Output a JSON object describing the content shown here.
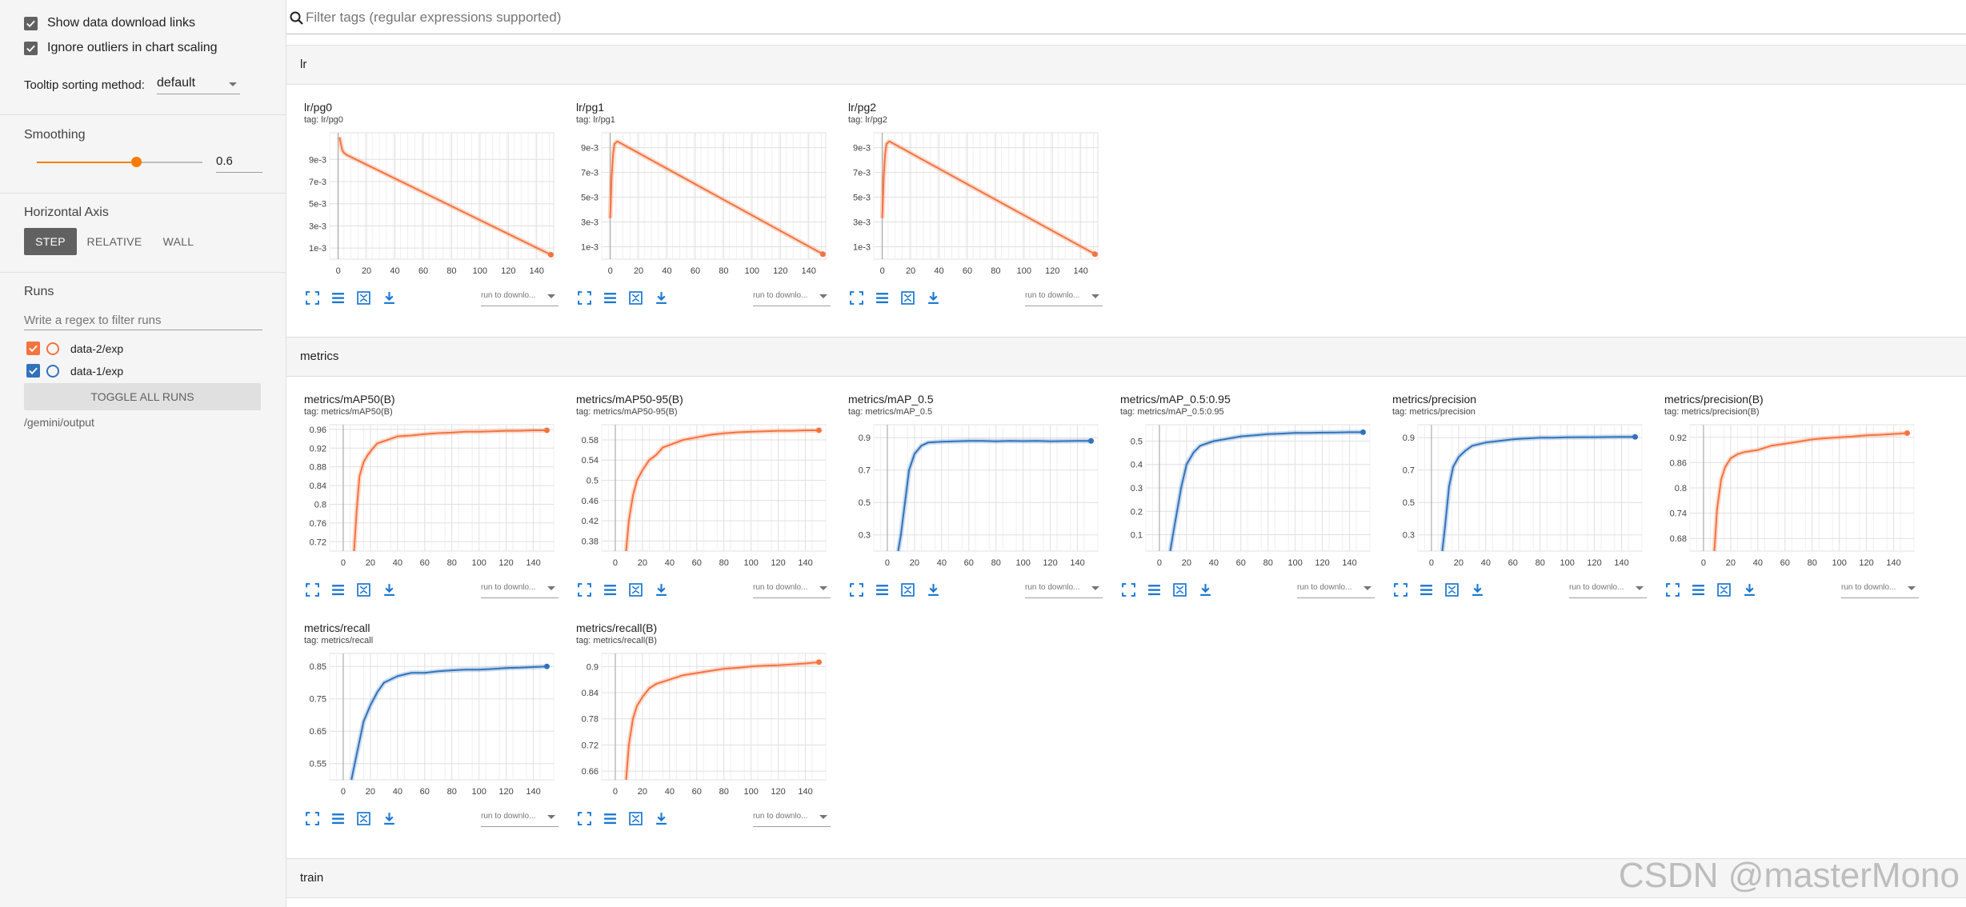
{
  "sidebar": {
    "show_download_links": "Show data download links",
    "ignore_outliers": "Ignore outliers in chart scaling",
    "tooltip_label": "Tooltip sorting method:",
    "tooltip_value": "default",
    "smoothing_label": "Smoothing",
    "smoothing_value": "0.6",
    "horizontal_axis_label": "Horizontal Axis",
    "axis_options": [
      "STEP",
      "RELATIVE",
      "WALL"
    ],
    "runs_label": "Runs",
    "runs_filter_placeholder": "Write a regex to filter runs",
    "runs": [
      {
        "name": "data-2/exp",
        "color": "#f4733f"
      },
      {
        "name": "data-1/exp",
        "color": "#3172bb"
      }
    ],
    "toggle_all": "TOGGLE ALL RUNS",
    "logdir": "/gemini/output"
  },
  "filter": {
    "placeholder": "Filter tags (regular expressions supported)"
  },
  "groups": [
    "lr",
    "metrics",
    "train"
  ],
  "card_run_select": "run to downlo...",
  "colors": {
    "orange": "#f4733f",
    "blue": "#3172bb",
    "accent": "#f57c00",
    "step_btn": "#616161"
  },
  "watermark": "CSDN @masterMono",
  "chart_data": [
    {
      "type": "line",
      "title": "lr/pg0",
      "tag": "tag: lr/pg0",
      "series_color": "orange",
      "xticks": [
        0,
        20,
        40,
        60,
        80,
        100,
        120,
        140
      ],
      "yticks": [
        {
          "label": "9e-3",
          "v": 0.009
        },
        {
          "label": "7e-3",
          "v": 0.007
        },
        {
          "label": "5e-3",
          "v": 0.005
        },
        {
          "label": "3e-3",
          "v": 0.003
        },
        {
          "label": "1e-3",
          "v": 0.001
        }
      ],
      "xlim": [
        -6,
        152
      ],
      "ylim": [
        0,
        0.0114
      ],
      "x": [
        1,
        2,
        3,
        4,
        6,
        150
      ],
      "y": [
        0.011,
        0.0103,
        0.0098,
        0.0096,
        0.0094,
        0.0004
      ]
    },
    {
      "type": "line",
      "title": "lr/pg1",
      "tag": "tag: lr/pg1",
      "series_color": "orange",
      "xticks": [
        0,
        20,
        40,
        60,
        80,
        100,
        120,
        140
      ],
      "yticks": [
        {
          "label": "9e-3",
          "v": 0.009
        },
        {
          "label": "7e-3",
          "v": 0.007
        },
        {
          "label": "5e-3",
          "v": 0.005
        },
        {
          "label": "3e-3",
          "v": 0.003
        },
        {
          "label": "1e-3",
          "v": 0.001
        }
      ],
      "xlim": [
        -6,
        152
      ],
      "ylim": [
        0,
        0.0102
      ],
      "x": [
        0,
        1,
        2,
        3,
        5,
        150
      ],
      "y": [
        0.0033,
        0.0066,
        0.0085,
        0.0093,
        0.0095,
        0.0004
      ]
    },
    {
      "type": "line",
      "title": "lr/pg2",
      "tag": "tag: lr/pg2",
      "series_color": "orange",
      "xticks": [
        0,
        20,
        40,
        60,
        80,
        100,
        120,
        140
      ],
      "yticks": [
        {
          "label": "9e-3",
          "v": 0.009
        },
        {
          "label": "7e-3",
          "v": 0.007
        },
        {
          "label": "5e-3",
          "v": 0.005
        },
        {
          "label": "3e-3",
          "v": 0.003
        },
        {
          "label": "1e-3",
          "v": 0.001
        }
      ],
      "xlim": [
        -6,
        152
      ],
      "ylim": [
        0,
        0.0102
      ],
      "x": [
        0,
        1,
        2,
        3,
        5,
        150
      ],
      "y": [
        0.0033,
        0.0066,
        0.0085,
        0.0093,
        0.0095,
        0.0004
      ]
    },
    {
      "type": "line",
      "title": "metrics/mAP50(B)",
      "tag": "tag: metrics/mAP50(B)",
      "series_color": "orange",
      "xticks": [
        0,
        20,
        40,
        60,
        80,
        100,
        120,
        140
      ],
      "yticks": [
        {
          "label": "0.96",
          "v": 0.96
        },
        {
          "label": "0.92",
          "v": 0.92
        },
        {
          "label": "0.88",
          "v": 0.88
        },
        {
          "label": "0.84",
          "v": 0.84
        },
        {
          "label": "0.8",
          "v": 0.8
        },
        {
          "label": "0.76",
          "v": 0.76
        },
        {
          "label": "0.72",
          "v": 0.72
        }
      ],
      "xlim": [
        -10,
        155
      ],
      "ylim": [
        0.7,
        0.97
      ],
      "x": [
        8,
        10,
        12,
        15,
        18,
        22,
        25,
        30,
        35,
        40,
        50,
        60,
        70,
        80,
        90,
        100,
        110,
        120,
        130,
        140,
        150
      ],
      "y": [
        0.7,
        0.79,
        0.86,
        0.89,
        0.905,
        0.92,
        0.93,
        0.935,
        0.94,
        0.945,
        0.947,
        0.95,
        0.952,
        0.953,
        0.955,
        0.955,
        0.956,
        0.957,
        0.957,
        0.958,
        0.958
      ]
    },
    {
      "type": "line",
      "title": "metrics/mAP50-95(B)",
      "tag": "tag: metrics/mAP50-95(B)",
      "series_color": "orange",
      "xticks": [
        0,
        20,
        40,
        60,
        80,
        100,
        120,
        140
      ],
      "yticks": [
        {
          "label": "0.58",
          "v": 0.58
        },
        {
          "label": "0.54",
          "v": 0.54
        },
        {
          "label": "0.5",
          "v": 0.5
        },
        {
          "label": "0.46",
          "v": 0.46
        },
        {
          "label": "0.42",
          "v": 0.42
        },
        {
          "label": "0.38",
          "v": 0.38
        }
      ],
      "xlim": [
        -10,
        155
      ],
      "ylim": [
        0.36,
        0.61
      ],
      "x": [
        8,
        10,
        13,
        16,
        20,
        25,
        30,
        35,
        40,
        50,
        60,
        70,
        80,
        90,
        100,
        110,
        120,
        130,
        140,
        150
      ],
      "y": [
        0.36,
        0.42,
        0.47,
        0.5,
        0.52,
        0.54,
        0.55,
        0.565,
        0.57,
        0.58,
        0.585,
        0.59,
        0.593,
        0.595,
        0.596,
        0.597,
        0.598,
        0.598,
        0.599,
        0.599
      ]
    },
    {
      "type": "line",
      "title": "metrics/mAP_0.5",
      "tag": "tag: metrics/mAP_0.5",
      "series_color": "blue",
      "xticks": [
        0,
        20,
        40,
        60,
        80,
        100,
        120,
        140
      ],
      "yticks": [
        {
          "label": "0.9",
          "v": 0.9
        },
        {
          "label": "0.7",
          "v": 0.7
        },
        {
          "label": "0.5",
          "v": 0.5
        },
        {
          "label": "0.3",
          "v": 0.3
        }
      ],
      "xlim": [
        -10,
        155
      ],
      "ylim": [
        0.2,
        0.98
      ],
      "x": [
        8,
        10,
        13,
        16,
        20,
        25,
        30,
        40,
        50,
        60,
        70,
        80,
        90,
        100,
        110,
        120,
        130,
        140,
        150
      ],
      "y": [
        0.2,
        0.3,
        0.5,
        0.7,
        0.8,
        0.85,
        0.87,
        0.875,
        0.878,
        0.88,
        0.88,
        0.878,
        0.88,
        0.879,
        0.88,
        0.878,
        0.879,
        0.88,
        0.88
      ]
    },
    {
      "type": "line",
      "title": "metrics/mAP_0.5:0.95",
      "tag": "tag: metrics/mAP_0.5:0.95",
      "series_color": "blue",
      "xticks": [
        0,
        20,
        40,
        60,
        80,
        100,
        120,
        140
      ],
      "yticks": [
        {
          "label": "0.5",
          "v": 0.5
        },
        {
          "label": "0.4",
          "v": 0.4
        },
        {
          "label": "0.3",
          "v": 0.3
        },
        {
          "label": "0.2",
          "v": 0.2
        },
        {
          "label": "0.1",
          "v": 0.1
        }
      ],
      "xlim": [
        -10,
        155
      ],
      "ylim": [
        0.03,
        0.57
      ],
      "x": [
        8,
        10,
        13,
        16,
        20,
        25,
        30,
        40,
        50,
        60,
        70,
        80,
        90,
        100,
        110,
        120,
        130,
        140,
        150
      ],
      "y": [
        0.03,
        0.1,
        0.2,
        0.3,
        0.4,
        0.45,
        0.48,
        0.5,
        0.51,
        0.52,
        0.525,
        0.53,
        0.532,
        0.535,
        0.535,
        0.536,
        0.537,
        0.538,
        0.538
      ]
    },
    {
      "type": "line",
      "title": "metrics/precision",
      "tag": "tag: metrics/precision",
      "series_color": "blue",
      "xticks": [
        0,
        20,
        40,
        60,
        80,
        100,
        120,
        140
      ],
      "yticks": [
        {
          "label": "0.9",
          "v": 0.9
        },
        {
          "label": "0.7",
          "v": 0.7
        },
        {
          "label": "0.5",
          "v": 0.5
        },
        {
          "label": "0.3",
          "v": 0.3
        }
      ],
      "xlim": [
        -10,
        155
      ],
      "ylim": [
        0.2,
        0.98
      ],
      "x": [
        8,
        10,
        13,
        16,
        20,
        25,
        30,
        40,
        50,
        60,
        70,
        80,
        90,
        100,
        110,
        120,
        130,
        140,
        150
      ],
      "y": [
        0.2,
        0.35,
        0.6,
        0.72,
        0.78,
        0.82,
        0.85,
        0.87,
        0.88,
        0.89,
        0.895,
        0.9,
        0.9,
        0.902,
        0.903,
        0.903,
        0.904,
        0.905,
        0.905
      ]
    },
    {
      "type": "line",
      "title": "metrics/precision(B)",
      "tag": "tag: metrics/precision(B)",
      "series_color": "orange",
      "xticks": [
        0,
        20,
        40,
        60,
        80,
        100,
        120,
        140
      ],
      "yticks": [
        {
          "label": "0.92",
          "v": 0.92
        },
        {
          "label": "0.86",
          "v": 0.86
        },
        {
          "label": "0.8",
          "v": 0.8
        },
        {
          "label": "0.74",
          "v": 0.74
        },
        {
          "label": "0.68",
          "v": 0.68
        }
      ],
      "xlim": [
        -10,
        155
      ],
      "ylim": [
        0.65,
        0.95
      ],
      "x": [
        8,
        10,
        13,
        16,
        20,
        25,
        30,
        40,
        50,
        60,
        70,
        80,
        90,
        100,
        110,
        120,
        130,
        140,
        150
      ],
      "y": [
        0.65,
        0.75,
        0.82,
        0.85,
        0.87,
        0.88,
        0.885,
        0.89,
        0.9,
        0.905,
        0.91,
        0.915,
        0.918,
        0.92,
        0.922,
        0.925,
        0.926,
        0.928,
        0.93
      ]
    },
    {
      "type": "line",
      "title": "metrics/recall",
      "tag": "tag: metrics/recall",
      "series_color": "blue",
      "xticks": [
        0,
        20,
        40,
        60,
        80,
        100,
        120,
        140
      ],
      "yticks": [
        {
          "label": "0.85",
          "v": 0.85
        },
        {
          "label": "0.75",
          "v": 0.75
        },
        {
          "label": "0.65",
          "v": 0.65
        },
        {
          "label": "0.55",
          "v": 0.55
        }
      ],
      "xlim": [
        -10,
        155
      ],
      "ylim": [
        0.5,
        0.89
      ],
      "x": [
        6,
        9,
        12,
        15,
        20,
        25,
        30,
        40,
        50,
        60,
        70,
        80,
        90,
        100,
        110,
        120,
        130,
        140,
        150
      ],
      "y": [
        0.5,
        0.56,
        0.62,
        0.68,
        0.73,
        0.77,
        0.8,
        0.82,
        0.83,
        0.83,
        0.835,
        0.838,
        0.84,
        0.84,
        0.842,
        0.845,
        0.846,
        0.848,
        0.85
      ]
    },
    {
      "type": "line",
      "title": "metrics/recall(B)",
      "tag": "tag: metrics/recall(B)",
      "series_color": "orange",
      "xticks": [
        0,
        20,
        40,
        60,
        80,
        100,
        120,
        140
      ],
      "yticks": [
        {
          "label": "0.9",
          "v": 0.9
        },
        {
          "label": "0.84",
          "v": 0.84
        },
        {
          "label": "0.78",
          "v": 0.78
        },
        {
          "label": "0.72",
          "v": 0.72
        },
        {
          "label": "0.66",
          "v": 0.66
        }
      ],
      "xlim": [
        -10,
        155
      ],
      "ylim": [
        0.64,
        0.93
      ],
      "x": [
        8,
        10,
        13,
        16,
        20,
        25,
        30,
        40,
        50,
        60,
        70,
        80,
        90,
        100,
        110,
        120,
        130,
        140,
        150
      ],
      "y": [
        0.64,
        0.72,
        0.78,
        0.81,
        0.83,
        0.85,
        0.86,
        0.87,
        0.88,
        0.885,
        0.89,
        0.895,
        0.897,
        0.9,
        0.902,
        0.903,
        0.905,
        0.907,
        0.91
      ]
    }
  ]
}
